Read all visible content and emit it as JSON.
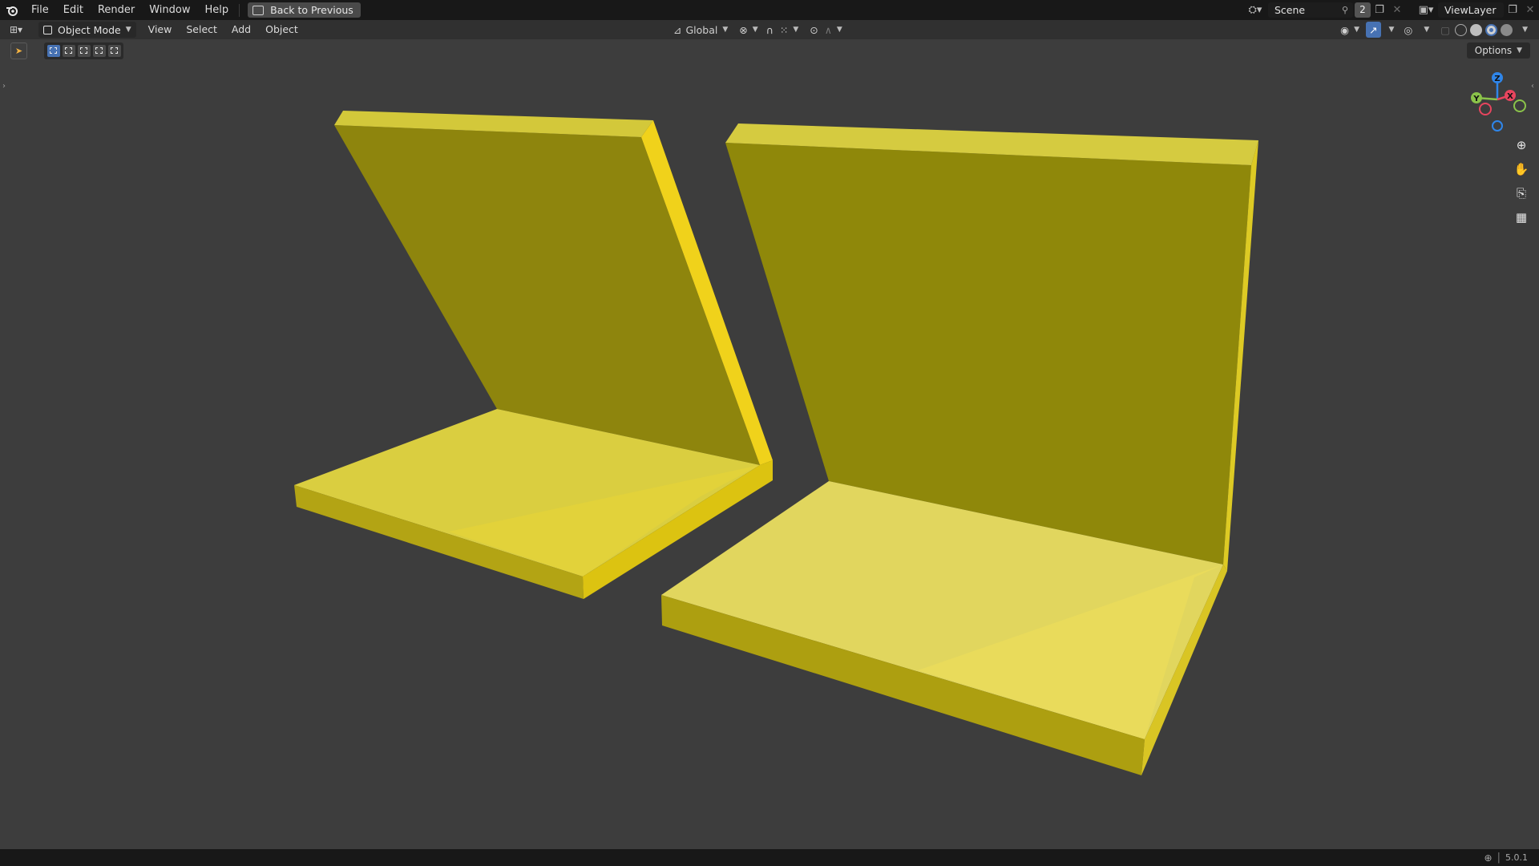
{
  "menu": {
    "items": [
      "File",
      "Edit",
      "Render",
      "Window",
      "Help"
    ],
    "back_label": "Back to Previous"
  },
  "scene": {
    "name": "Scene",
    "users": "2",
    "view_layer": "ViewLayer"
  },
  "header": {
    "mode": "Object Mode",
    "menus": [
      "View",
      "Select",
      "Add",
      "Object"
    ],
    "transform_orientation": "Global",
    "options_label": "Options"
  },
  "gizmo": {
    "z_label": "Z",
    "y_label": "Y",
    "x_label": "X"
  },
  "colors": {
    "accent": "#4772b3",
    "axis_x": "#e8455e",
    "axis_y": "#8bc34a",
    "axis_z": "#2f86ea",
    "object_yellow": "#e9d63f"
  },
  "status": {
    "version": "5.0.1"
  }
}
